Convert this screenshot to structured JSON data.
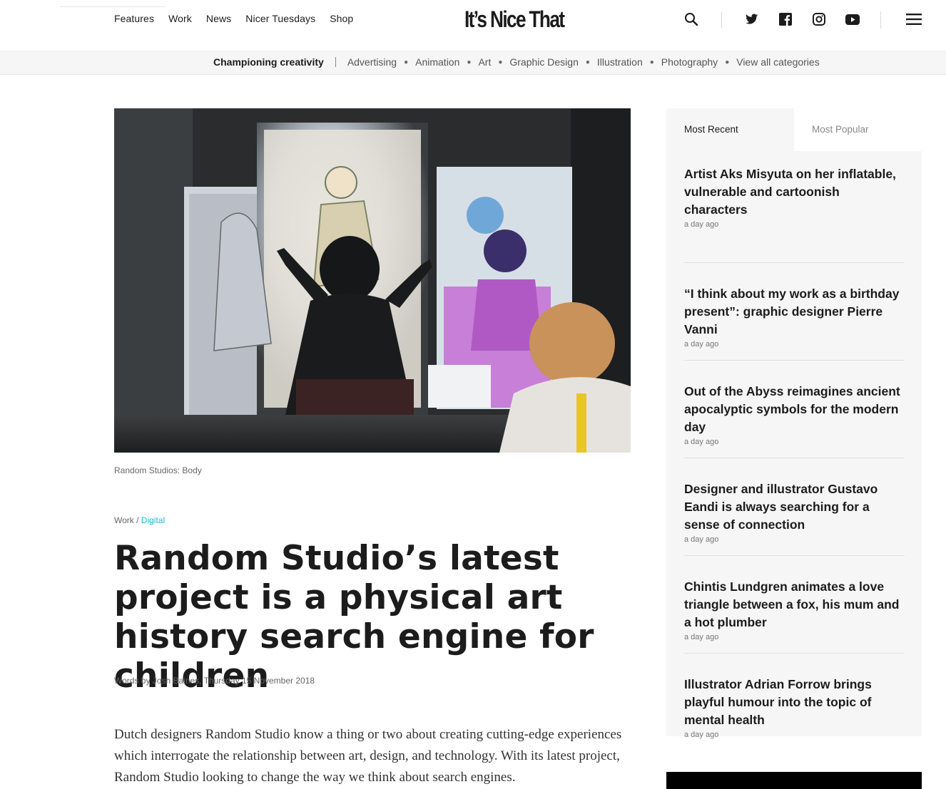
{
  "header": {
    "nav": [
      "Features",
      "Work",
      "News",
      "Nicer Tuesdays",
      "Shop"
    ],
    "logo": "It’s Nice That",
    "icons": [
      "search-icon",
      "twitter-icon",
      "facebook-icon",
      "instagram-icon",
      "youtube-icon",
      "menu-icon"
    ]
  },
  "categories": {
    "lead": "Championing creativity",
    "items": [
      "Advertising",
      "Animation",
      "Art",
      "Graphic Design",
      "Illustration",
      "Photography",
      "View all categories"
    ]
  },
  "article": {
    "caption": "Random Studios: Body",
    "breadcrumb_section": "Work",
    "breadcrumb_sep": " / ",
    "breadcrumb_link": "Digital",
    "title": "Random Studio’s latest project is a physical art history search engine for children",
    "byline": "Words by Josh Baines, Thursday 15 November 2018",
    "body": "Dutch designers Random Studio know a thing or two about creating cutting-edge experiences which interrogate the relationship between art, design, and technology. With its latest project, Random Studio looking to change the way we think about search engines."
  },
  "sidebar": {
    "tabs": [
      "Most Recent",
      "Most Popular"
    ],
    "articles": [
      {
        "title": "Artist Aks Misyuta on her inflatable, vulnerable and cartoonish characters",
        "time": "a day ago"
      },
      {
        "title": "“I think about my work as a birthday present”: graphic designer Pierre Vanni",
        "time": "a day ago"
      },
      {
        "title": "Out of the Abyss reimagines ancient apocalyptic symbols for the modern day",
        "time": "a day ago"
      },
      {
        "title": "Designer and illustrator Gustavo Eandi is always searching for a sense of connection",
        "time": "a day ago"
      },
      {
        "title": "Chintis Lundgren animates a love triangle between a fox, his mum and a hot plumber",
        "time": "a day ago"
      },
      {
        "title": "Illustrator Adrian Forrow brings playful humour into the topic of mental health",
        "time": "a day ago"
      }
    ]
  },
  "colors": {
    "accent_link": "#20b6d6",
    "text": "#1c1c1c",
    "sidebar_bg": "#f6f6f6"
  }
}
